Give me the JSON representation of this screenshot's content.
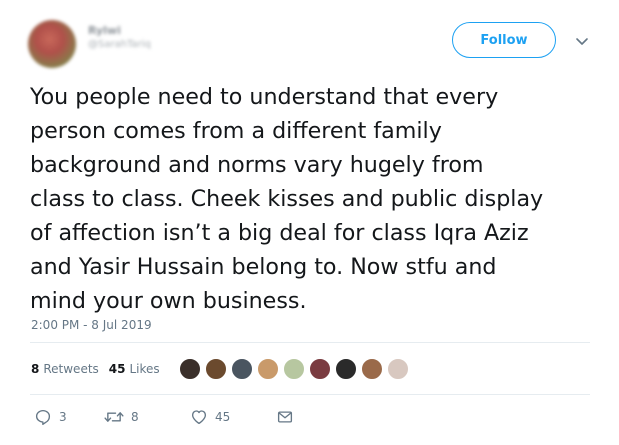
{
  "user": {
    "display_name": "Rylwi",
    "handle": "@SarahTariq"
  },
  "follow_label": "Follow",
  "tweet": {
    "lines": [
      "You people need to understand that every",
      "person comes from a different family",
      "background and norms vary hugely from",
      "class to class. Cheek kisses and public display",
      "of affection isn’t a big deal for class Iqra Aziz",
      "and Yasir Hussain belong to. Now stfu and",
      "mind your own business."
    ],
    "timestamp": "2:00 PM - 8 Jul 2019"
  },
  "stats": {
    "retweets_count": "8",
    "retweets_label": "Retweets",
    "likes_count": "45",
    "likes_label": "Likes"
  },
  "likers": [
    {
      "icon": "liker-avatar",
      "color": "#3a2f2a"
    },
    {
      "icon": "liker-avatar",
      "color": "#6b4a2e"
    },
    {
      "icon": "liker-avatar",
      "color": "#4a5560"
    },
    {
      "icon": "liker-avatar",
      "color": "#c99a6a"
    },
    {
      "icon": "liker-avatar",
      "color": "#b7c7a0"
    },
    {
      "icon": "liker-avatar",
      "color": "#7a3b40"
    },
    {
      "icon": "liker-avatar",
      "color": "#2a2a2a"
    },
    {
      "icon": "liker-avatar",
      "color": "#9a6a4a"
    },
    {
      "icon": "liker-avatar",
      "color": "#d8c8c0"
    }
  ],
  "actions": {
    "reply_count": "3",
    "retweet_count": "8",
    "like_count": "45"
  },
  "colors": {
    "accent": "#1da1f2",
    "secondary_text": "#657786",
    "text": "#14171a"
  }
}
